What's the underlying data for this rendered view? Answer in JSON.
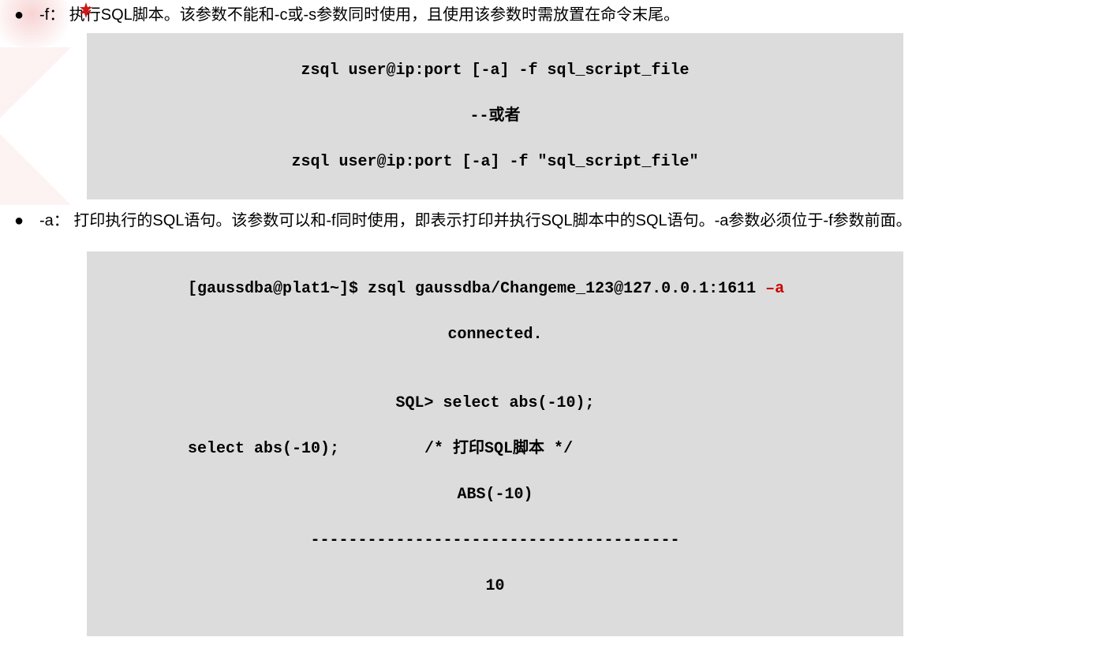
{
  "items": [
    {
      "term": "-f：",
      "desc": "执行SQL脚本。该参数不能和-c或-s参数同时使用，且使用该参数时需放置在命令末尾。"
    },
    {
      "term": "-a：",
      "desc": "打印执行的SQL语句。该参数可以和-f同时使用，即表示打印并执行SQL脚本中的SQL语句。-a参数必须位于-f参数前面。"
    }
  ],
  "code1": {
    "l1": "zsql user@ip:port [-a] -f sql_script_file",
    "l2": "--或者",
    "l3": "zsql user@ip:port [-a] -f \"sql_script_file\""
  },
  "code2": {
    "l1a": "[gaussdba@plat1~]$ zsql gaussdba/Changeme_123@127.0.0.1:1611 ",
    "l1flag": "–a",
    "l2": "connected.",
    "l3": "",
    "l4": "SQL> select abs(-10);",
    "l5a": "select abs(-10);",
    "l5b": "         /* 打印SQL脚本 */",
    "l6": "ABS(-10)",
    "l7": "---------------------------------------",
    "l8": "10"
  }
}
